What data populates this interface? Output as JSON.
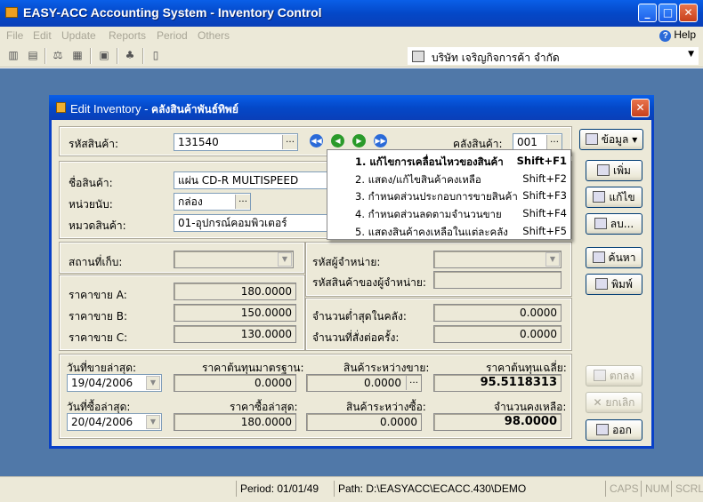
{
  "window": {
    "title": "EASY-ACC Accounting System - Inventory Control"
  },
  "menu": {
    "items": [
      "File",
      "Edit",
      "Update",
      "Reports",
      "Period",
      "Others"
    ],
    "help": "Help"
  },
  "toolbar": {
    "company": "บริษัท เจริญกิจการค้า จำกัด"
  },
  "dialog": {
    "title": "Edit Inventory - ",
    "title_bold": "คลังสินค้าพันธ์ทิพย์",
    "fields": {
      "code_label": "รหัสสินค้า:",
      "code_value": "131540",
      "warehouse_label": "คลังสินค้า:",
      "warehouse_value": "001",
      "name_label": "ชื่อสินค้า:",
      "name_value": "แผ่น CD-R MULTISPEED",
      "unit_label": "หน่วยนับ:",
      "unit_value": "กล่อง",
      "category_label": "หมวดสินค้า:",
      "category_value": "01-อุปกรณ์คอมพิวเตอร์",
      "location_label": "สถานที่เก็บ:",
      "location_value": "",
      "supplier_label": "รหัสผู้จำหน่าย:",
      "supplier_value": "",
      "supplier_item_label": "รหัสสินค้าของผู้จำหน่าย:",
      "supplier_item_value": "",
      "price_a_label": "ราคาขาย A:",
      "price_a": "180.0000",
      "price_b_label": "ราคาขาย B:",
      "price_b": "150.0000",
      "price_c_label": "ราคาขาย C:",
      "price_c": "130.0000",
      "min_stock_label": "จำนวนต่ำสุดในคลัง:",
      "min_stock": "0.0000",
      "reorder_label": "จำนวนที่สั่งต่อครั้ง:",
      "reorder": "0.0000",
      "last_sale_label": "วันที่ขายล่าสุด:",
      "last_sale": "19/04/2006",
      "std_cost_label": "ราคาต้นทุนมาตรฐาน:",
      "std_cost": "0.0000",
      "pending_sale_label": "สินค้าระหว่างขาย:",
      "pending_sale": "0.0000",
      "avg_cost_label": "ราคาต้นทุนเฉลี่ย:",
      "avg_cost": "95.5118313",
      "last_buy_label": "วันที่ซื้อล่าสุด:",
      "last_buy": "20/04/2006",
      "last_buy_price_label": "ราคาซื้อล่าสุด:",
      "last_buy_price": "180.0000",
      "pending_buy_label": "สินค้าระหว่างซื้อ:",
      "pending_buy": "0.0000",
      "on_hand_label": "จำนวนคงเหลือ:",
      "on_hand": "98.0000"
    },
    "buttons": {
      "info": "ข้อมูล",
      "add": "เพิ่ม",
      "edit": "แก้ไข",
      "delete": "ลบ...",
      "search": "ค้นหา",
      "print": "พิมพ์",
      "ok": "ตกลง",
      "cancel": "ยกเลิก",
      "exit": "ออก"
    },
    "popup": [
      {
        "label": "1. แก้ไขการเคลื่อนไหวของสินค้า",
        "key": "Shift+F1"
      },
      {
        "label": "2. แสดง/แก้ไขสินค้าคงเหลือ",
        "key": "Shift+F2"
      },
      {
        "label": "3. กำหนดส่วนประกอบการขายสินค้า",
        "key": "Shift+F3"
      },
      {
        "label": "4. กำหนดส่วนลดตามจำนวนขาย",
        "key": "Shift+F4"
      },
      {
        "label": "5. แสดงสินค้าคงเหลือในแต่ละคลัง",
        "key": "Shift+F5"
      }
    ]
  },
  "status": {
    "period": "Period: 01/01/49",
    "path": "Path: D:\\EASYACC\\ECACC.430\\DEMO",
    "caps": "CAPS",
    "num": "NUM",
    "scrl": "SCRL"
  },
  "colors": {
    "title_blue": "#0448c8",
    "desktop": "#5078a8",
    "panel": "#ece9d8"
  }
}
